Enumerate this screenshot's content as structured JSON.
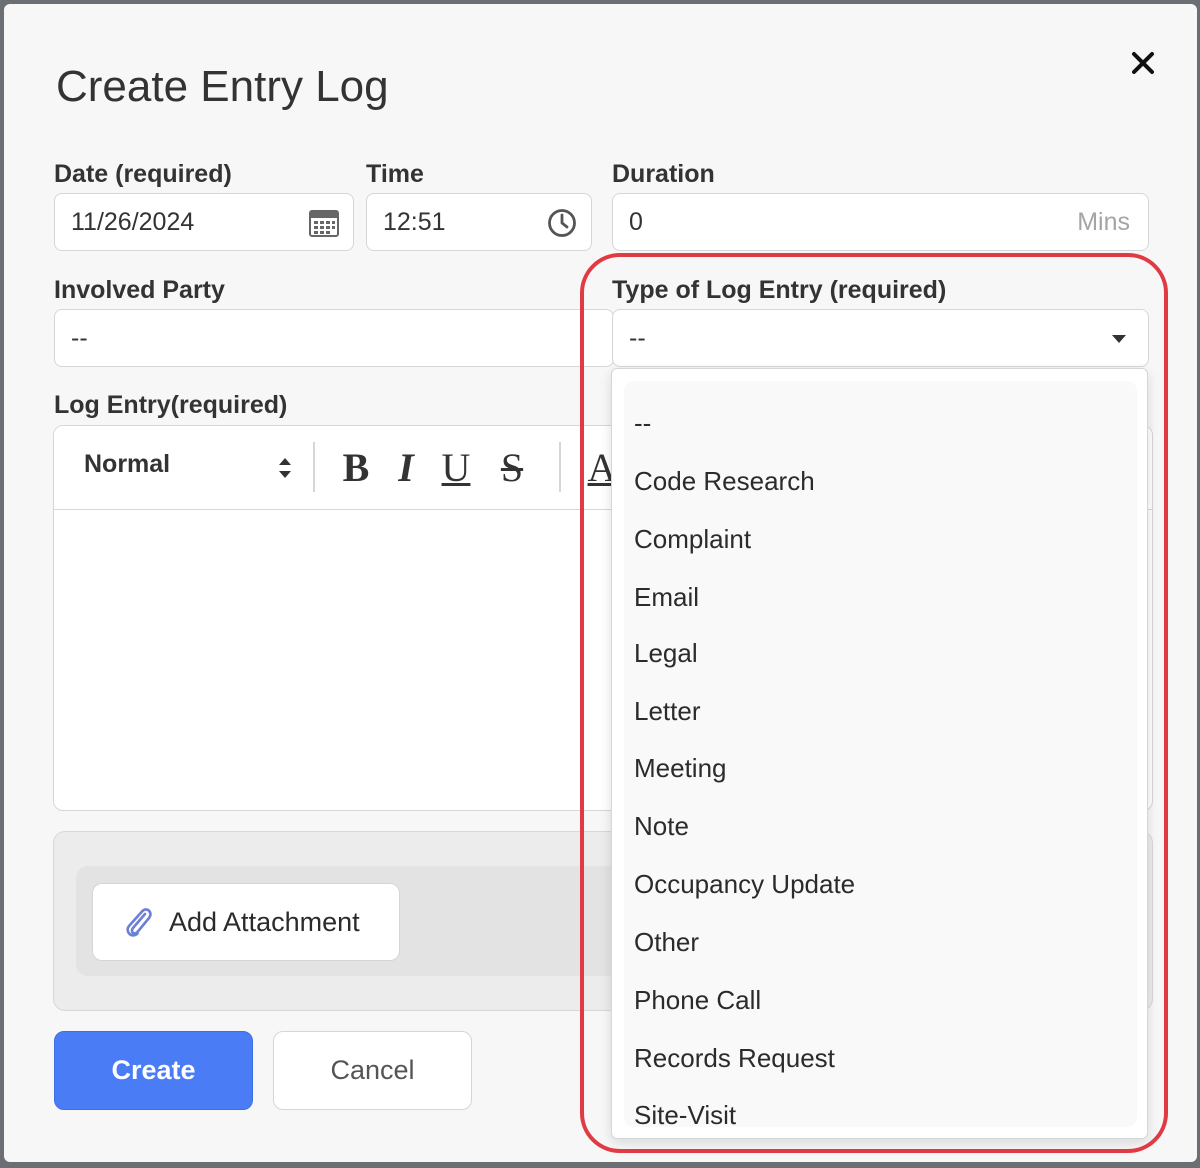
{
  "dialog": {
    "title": "Create Entry Log",
    "close_icon": "close-icon"
  },
  "fields": {
    "date": {
      "label": "Date (required)",
      "value": "11/26/2024",
      "icon": "calendar-icon"
    },
    "time": {
      "label": "Time",
      "value": "12:51",
      "icon": "clock-icon"
    },
    "duration": {
      "label": "Duration",
      "value": "0",
      "suffix": "Mins"
    },
    "involved_party": {
      "label": "Involved Party",
      "value": "--"
    },
    "log_type": {
      "label": "Type of Log Entry (required)",
      "value": "--",
      "icon": "caret-down-icon"
    },
    "log_entry": {
      "label": "Log Entry(required)"
    }
  },
  "editor": {
    "format_select": "Normal",
    "bold": "B",
    "italic": "I",
    "underline": "U",
    "strike": "S",
    "text_color": "A"
  },
  "attachment": {
    "button_label": "Add Attachment",
    "icon": "paperclip-icon"
  },
  "actions": {
    "create": "Create",
    "cancel": "Cancel"
  },
  "dropdown": {
    "options": [
      "--",
      "Code Research",
      "Complaint",
      "Email",
      "Legal",
      "Letter",
      "Meeting",
      "Note",
      "Occupancy Update",
      "Other",
      "Phone Call",
      "Records Request",
      "Site-Visit"
    ]
  },
  "colors": {
    "primary": "#4a7cf6",
    "highlight": "#e03a43",
    "attachment_icon": "#6b7fd6"
  }
}
